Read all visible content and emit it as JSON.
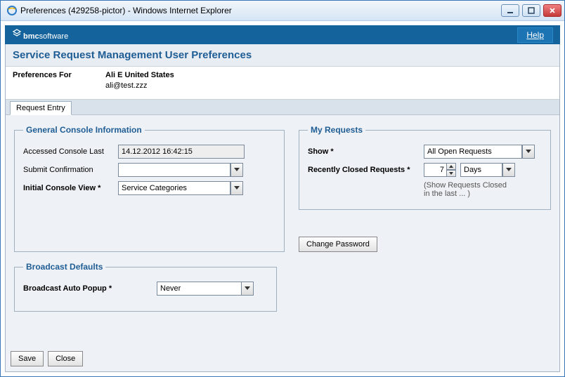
{
  "window": {
    "title": "Preferences (429258-pictor) - Windows Internet Explorer"
  },
  "brand": {
    "bold": "bmc",
    "rest": "software"
  },
  "help": {
    "label": "Help"
  },
  "page": {
    "title": "Service Request Management User Preferences"
  },
  "prefs": {
    "label": "Preferences For",
    "name": "Ali E United States",
    "email": "ali@test.zzz"
  },
  "tab": {
    "label": "Request Entry"
  },
  "gci": {
    "legend": "General Console Information",
    "accessed_label": "Accessed Console Last",
    "accessed_value": "14.12.2012 16:42:15",
    "submit_label": "Submit Confirmation",
    "submit_value": "",
    "view_label": "Initial Console View *",
    "view_value": "Service Categories"
  },
  "my": {
    "legend": "My Requests",
    "show_label": "Show *",
    "show_value": "All Open Requests",
    "recent_label": "Recently Closed Requests *",
    "recent_value": "7",
    "recent_unit": "Days",
    "hint1": "(Show Requests Closed",
    "hint2": "in the last ... )"
  },
  "bcast": {
    "legend": "Broadcast Defaults",
    "label": "Broadcast Auto Popup *",
    "value": "Never"
  },
  "cp": {
    "label": "Change Password"
  },
  "actions": {
    "save": "Save",
    "close": "Close"
  }
}
